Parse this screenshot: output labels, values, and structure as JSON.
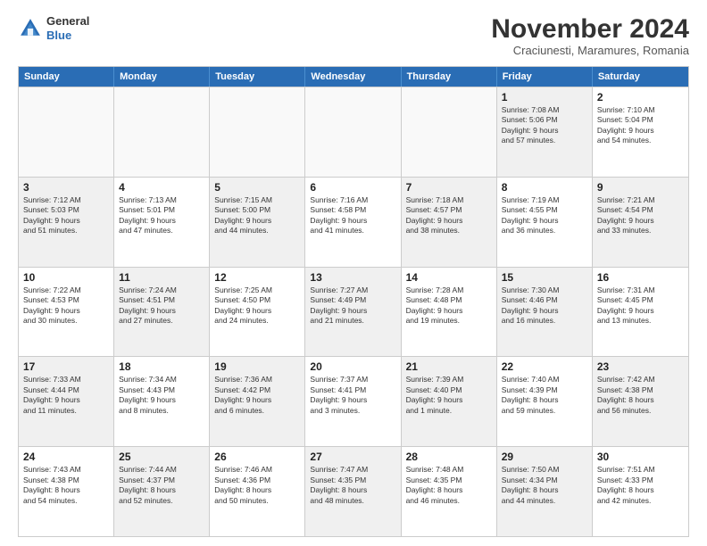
{
  "header": {
    "logo_line1": "General",
    "logo_line2": "Blue",
    "month": "November 2024",
    "location": "Craciunesti, Maramures, Romania"
  },
  "days_of_week": [
    "Sunday",
    "Monday",
    "Tuesday",
    "Wednesday",
    "Thursday",
    "Friday",
    "Saturday"
  ],
  "rows": [
    [
      {
        "day": "",
        "text": "",
        "empty": true
      },
      {
        "day": "",
        "text": "",
        "empty": true
      },
      {
        "day": "",
        "text": "",
        "empty": true
      },
      {
        "day": "",
        "text": "",
        "empty": true
      },
      {
        "day": "",
        "text": "",
        "empty": true
      },
      {
        "day": "1",
        "text": "Sunrise: 7:08 AM\nSunset: 5:06 PM\nDaylight: 9 hours\nand 57 minutes.",
        "shaded": true
      },
      {
        "day": "2",
        "text": "Sunrise: 7:10 AM\nSunset: 5:04 PM\nDaylight: 9 hours\nand 54 minutes.",
        "shaded": false
      }
    ],
    [
      {
        "day": "3",
        "text": "Sunrise: 7:12 AM\nSunset: 5:03 PM\nDaylight: 9 hours\nand 51 minutes.",
        "shaded": true
      },
      {
        "day": "4",
        "text": "Sunrise: 7:13 AM\nSunset: 5:01 PM\nDaylight: 9 hours\nand 47 minutes.",
        "shaded": false
      },
      {
        "day": "5",
        "text": "Sunrise: 7:15 AM\nSunset: 5:00 PM\nDaylight: 9 hours\nand 44 minutes.",
        "shaded": true
      },
      {
        "day": "6",
        "text": "Sunrise: 7:16 AM\nSunset: 4:58 PM\nDaylight: 9 hours\nand 41 minutes.",
        "shaded": false
      },
      {
        "day": "7",
        "text": "Sunrise: 7:18 AM\nSunset: 4:57 PM\nDaylight: 9 hours\nand 38 minutes.",
        "shaded": true
      },
      {
        "day": "8",
        "text": "Sunrise: 7:19 AM\nSunset: 4:55 PM\nDaylight: 9 hours\nand 36 minutes.",
        "shaded": false
      },
      {
        "day": "9",
        "text": "Sunrise: 7:21 AM\nSunset: 4:54 PM\nDaylight: 9 hours\nand 33 minutes.",
        "shaded": true
      }
    ],
    [
      {
        "day": "10",
        "text": "Sunrise: 7:22 AM\nSunset: 4:53 PM\nDaylight: 9 hours\nand 30 minutes.",
        "shaded": false
      },
      {
        "day": "11",
        "text": "Sunrise: 7:24 AM\nSunset: 4:51 PM\nDaylight: 9 hours\nand 27 minutes.",
        "shaded": true
      },
      {
        "day": "12",
        "text": "Sunrise: 7:25 AM\nSunset: 4:50 PM\nDaylight: 9 hours\nand 24 minutes.",
        "shaded": false
      },
      {
        "day": "13",
        "text": "Sunrise: 7:27 AM\nSunset: 4:49 PM\nDaylight: 9 hours\nand 21 minutes.",
        "shaded": true
      },
      {
        "day": "14",
        "text": "Sunrise: 7:28 AM\nSunset: 4:48 PM\nDaylight: 9 hours\nand 19 minutes.",
        "shaded": false
      },
      {
        "day": "15",
        "text": "Sunrise: 7:30 AM\nSunset: 4:46 PM\nDaylight: 9 hours\nand 16 minutes.",
        "shaded": true
      },
      {
        "day": "16",
        "text": "Sunrise: 7:31 AM\nSunset: 4:45 PM\nDaylight: 9 hours\nand 13 minutes.",
        "shaded": false
      }
    ],
    [
      {
        "day": "17",
        "text": "Sunrise: 7:33 AM\nSunset: 4:44 PM\nDaylight: 9 hours\nand 11 minutes.",
        "shaded": true
      },
      {
        "day": "18",
        "text": "Sunrise: 7:34 AM\nSunset: 4:43 PM\nDaylight: 9 hours\nand 8 minutes.",
        "shaded": false
      },
      {
        "day": "19",
        "text": "Sunrise: 7:36 AM\nSunset: 4:42 PM\nDaylight: 9 hours\nand 6 minutes.",
        "shaded": true
      },
      {
        "day": "20",
        "text": "Sunrise: 7:37 AM\nSunset: 4:41 PM\nDaylight: 9 hours\nand 3 minutes.",
        "shaded": false
      },
      {
        "day": "21",
        "text": "Sunrise: 7:39 AM\nSunset: 4:40 PM\nDaylight: 9 hours\nand 1 minute.",
        "shaded": true
      },
      {
        "day": "22",
        "text": "Sunrise: 7:40 AM\nSunset: 4:39 PM\nDaylight: 8 hours\nand 59 minutes.",
        "shaded": false
      },
      {
        "day": "23",
        "text": "Sunrise: 7:42 AM\nSunset: 4:38 PM\nDaylight: 8 hours\nand 56 minutes.",
        "shaded": true
      }
    ],
    [
      {
        "day": "24",
        "text": "Sunrise: 7:43 AM\nSunset: 4:38 PM\nDaylight: 8 hours\nand 54 minutes.",
        "shaded": false
      },
      {
        "day": "25",
        "text": "Sunrise: 7:44 AM\nSunset: 4:37 PM\nDaylight: 8 hours\nand 52 minutes.",
        "shaded": true
      },
      {
        "day": "26",
        "text": "Sunrise: 7:46 AM\nSunset: 4:36 PM\nDaylight: 8 hours\nand 50 minutes.",
        "shaded": false
      },
      {
        "day": "27",
        "text": "Sunrise: 7:47 AM\nSunset: 4:35 PM\nDaylight: 8 hours\nand 48 minutes.",
        "shaded": true
      },
      {
        "day": "28",
        "text": "Sunrise: 7:48 AM\nSunset: 4:35 PM\nDaylight: 8 hours\nand 46 minutes.",
        "shaded": false
      },
      {
        "day": "29",
        "text": "Sunrise: 7:50 AM\nSunset: 4:34 PM\nDaylight: 8 hours\nand 44 minutes.",
        "shaded": true
      },
      {
        "day": "30",
        "text": "Sunrise: 7:51 AM\nSunset: 4:33 PM\nDaylight: 8 hours\nand 42 minutes.",
        "shaded": false
      }
    ]
  ]
}
